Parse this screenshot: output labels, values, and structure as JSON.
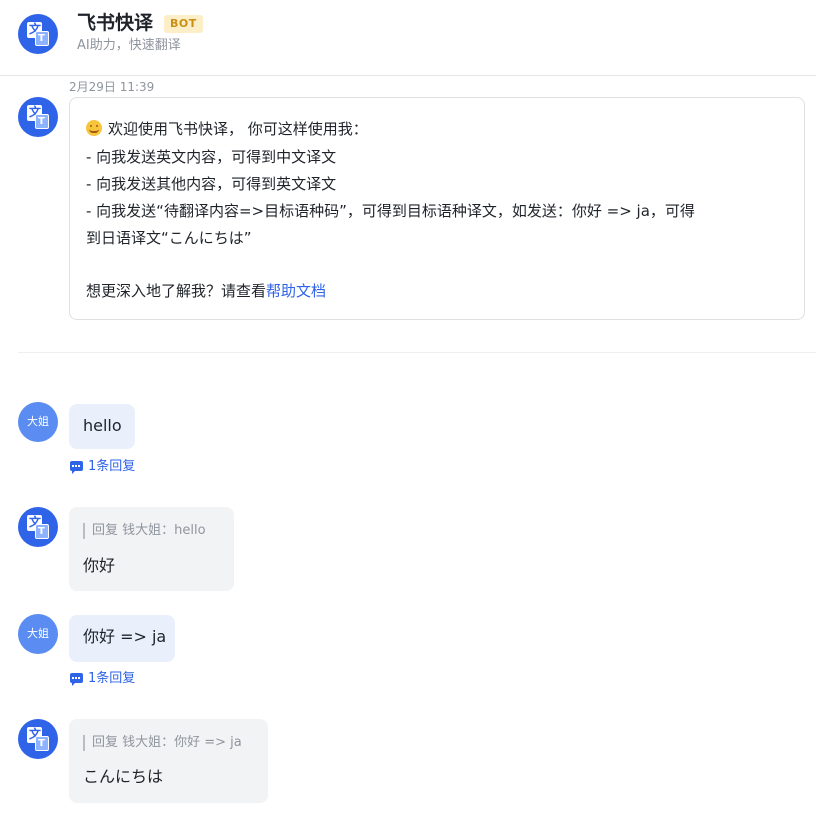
{
  "header": {
    "title": "飞书快译",
    "badge": "BOT",
    "subtitle": "AI助力，快速翻译"
  },
  "bot_avatar": {
    "icon": "translate-icon",
    "glyph_back": "文",
    "glyph_front": "T"
  },
  "welcome": {
    "timestamp": "2月29日 11:39",
    "emoji": "smiling-face-emoji",
    "line1": "欢迎使用飞书快译， 你可这样使用我：",
    "line2": "- 向我发送英文内容，可得到中文译文",
    "line3": "- 向我发送其他内容，可得到英文译文",
    "line4": "- 向我发送“待翻译内容=>目标语种码”，可得到目标语种译文，如发送：你好 => ja，可得",
    "line5": "到日语译文“こんにちは”",
    "help_prefix": "想更深入地了解我？请查看",
    "help_link": "帮助文档"
  },
  "messages": [
    {
      "user_avatar": "大姐",
      "text": "hello",
      "thread_label": "1条回复"
    },
    {
      "reply_quote": "回复 钱大姐：hello",
      "reply_text": "你好"
    },
    {
      "user_avatar": "大姐",
      "text": "你好 => ja",
      "thread_label": "1条回复"
    },
    {
      "reply_quote": "回复 钱大姐：你好 => ja",
      "reply_text": "こんにちは"
    }
  ],
  "colors": {
    "accent": "#2f63e8",
    "badge_bg": "#fcefc7",
    "badge_text": "#c98f12",
    "user_bubble": "#eaf0fb",
    "reply_bubble": "#f2f3f5"
  }
}
